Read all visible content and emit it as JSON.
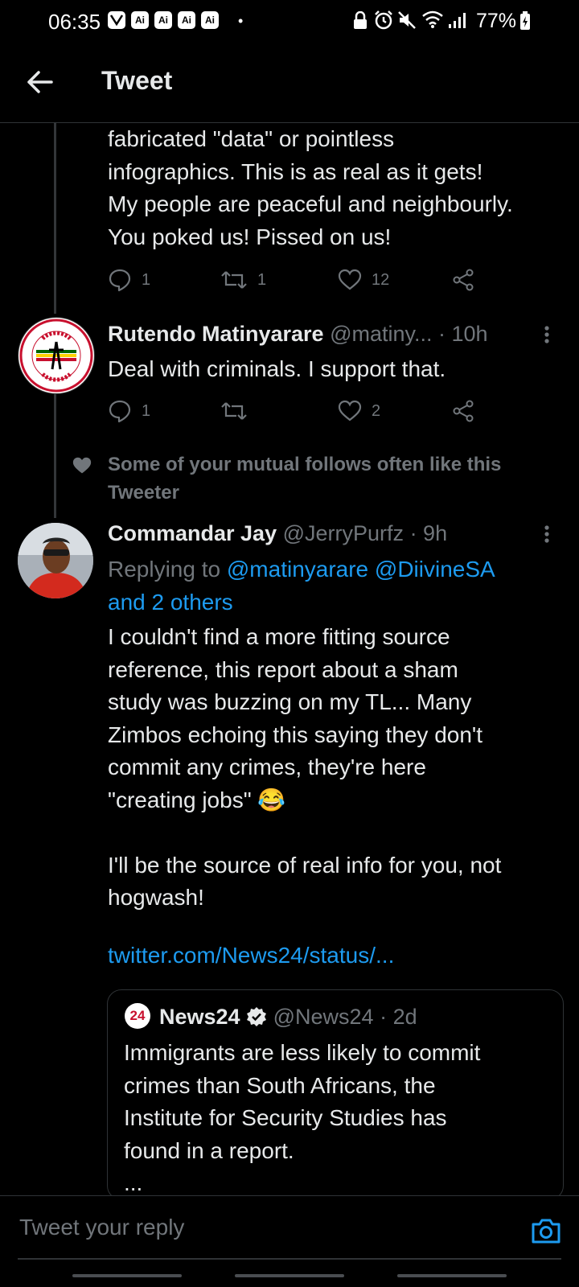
{
  "status_bar": {
    "time": "06:35",
    "app_badges": [
      "ai-app-icon",
      "Ai",
      "Ai",
      "Ai",
      "Ai"
    ],
    "battery": "77%"
  },
  "header": {
    "title": "Tweet"
  },
  "tweet_fragment": {
    "text": "fabricated \"data\" or pointless\ninfographics. This is as real as it gets!\nMy people are peaceful and neighbourly.\nYou poked us! Pissed on us!",
    "replies": "1",
    "retweets": "1",
    "likes": "12"
  },
  "tweet_rutendo": {
    "name": "Rutendo Matinyarare",
    "handle": "@matiny...",
    "time": "· 10h",
    "text": "Deal with criminals. I support that.",
    "replies": "1",
    "retweets": "",
    "likes": "2"
  },
  "social_context": {
    "text": "Some of your mutual follows often like this Tweeter"
  },
  "tweet_jay": {
    "name": "Commandar Jay",
    "handle": "@JerryPurfz",
    "time": "· 9h",
    "replying_prefix": "Replying to ",
    "replying_mentions": "@matinyarare @DiivineSA",
    "replying_others": "and 2 others",
    "text": "I couldn't find a more fitting source\nreference, this report about a sham\nstudy was buzzing on my TL... Many\nZimbos echoing this saying they don't\ncommit any crimes, they're here\n\"creating jobs\" 😂\n\nI'll be the source of real info for you, not\nhogwash!",
    "link": "twitter.com/News24/status/..."
  },
  "quoted_tweet": {
    "logo_text": "24",
    "name": "News24",
    "handle": "@News24",
    "time": "· 2d",
    "text": "Immigrants are less likely to commit\ncrimes than South Africans, the\nInstitute for Security Studies has\nfound in a report.\n..."
  },
  "reply": {
    "placeholder": "Tweet your reply"
  },
  "colors": {
    "background": "#000000",
    "accent": "#1d9bf0",
    "muted": "#71767b",
    "text": "#e7e9ea"
  }
}
